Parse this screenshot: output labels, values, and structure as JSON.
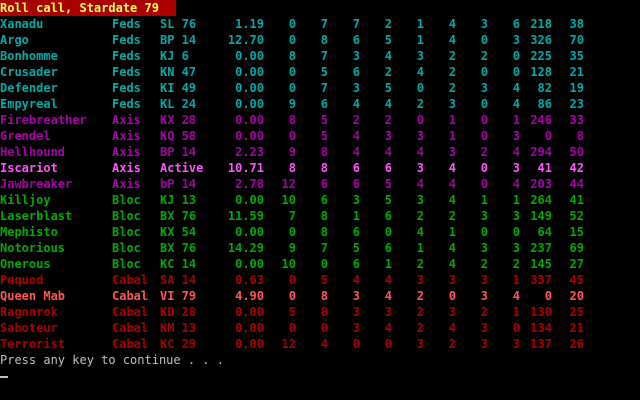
{
  "title": "Roll call, Stardate 79",
  "colors": {
    "background": "#000000",
    "title_bg": "#AA0000",
    "title_fg": "#FFFF55",
    "Feds": "#00AAAA",
    "Axis_dim": "#AA00AA",
    "Axis_bright": "#FF55FF",
    "Bloc": "#00AA00",
    "Cabal_dim": "#AA0000",
    "Cabal_bright": "#FF5555",
    "prompt": "#C0C0C0"
  },
  "rows": [
    {
      "name": "Xanadu",
      "faction": "Feds",
      "status": "SL 76",
      "v1": "1.19",
      "c1": "0",
      "c2": "7",
      "c3": "7",
      "c4": "2",
      "c5": "1",
      "c6": "4",
      "c7": "3",
      "c8": "6",
      "c9": "218",
      "c10": "38",
      "color": "Feds"
    },
    {
      "name": "Argo",
      "faction": "Feds",
      "status": "BP 14",
      "v1": "12.70",
      "c1": "0",
      "c2": "8",
      "c3": "6",
      "c4": "5",
      "c5": "1",
      "c6": "4",
      "c7": "0",
      "c8": "3",
      "c9": "326",
      "c10": "70",
      "color": "Feds"
    },
    {
      "name": "Bonhomme",
      "faction": "Feds",
      "status": "KJ 6",
      "v1": "0.00",
      "c1": "8",
      "c2": "7",
      "c3": "3",
      "c4": "4",
      "c5": "3",
      "c6": "2",
      "c7": "2",
      "c8": "0",
      "c9": "225",
      "c10": "35",
      "color": "Feds"
    },
    {
      "name": "Crusader",
      "faction": "Feds",
      "status": "KN 47",
      "v1": "0.00",
      "c1": "0",
      "c2": "5",
      "c3": "6",
      "c4": "2",
      "c5": "4",
      "c6": "2",
      "c7": "0",
      "c8": "0",
      "c9": "128",
      "c10": "21",
      "color": "Feds"
    },
    {
      "name": "Defender",
      "faction": "Feds",
      "status": "KI 49",
      "v1": "0.00",
      "c1": "0",
      "c2": "7",
      "c3": "3",
      "c4": "5",
      "c5": "0",
      "c6": "2",
      "c7": "3",
      "c8": "4",
      "c9": "82",
      "c10": "19",
      "color": "Feds"
    },
    {
      "name": "Empyreal",
      "faction": "Feds",
      "status": "KL 24",
      "v1": "0.00",
      "c1": "9",
      "c2": "6",
      "c3": "4",
      "c4": "4",
      "c5": "2",
      "c6": "3",
      "c7": "0",
      "c8": "4",
      "c9": "86",
      "c10": "23",
      "color": "Feds"
    },
    {
      "name": "Firebreather",
      "faction": "Axis",
      "status": "KX 28",
      "v1": "0.00",
      "c1": "8",
      "c2": "5",
      "c3": "2",
      "c4": "2",
      "c5": "0",
      "c6": "1",
      "c7": "0",
      "c8": "1",
      "c9": "246",
      "c10": "33",
      "color": "Axis_dim"
    },
    {
      "name": "Grendel",
      "faction": "Axis",
      "status": "KQ 58",
      "v1": "0.00",
      "c1": "0",
      "c2": "5",
      "c3": "4",
      "c4": "3",
      "c5": "3",
      "c6": "1",
      "c7": "0",
      "c8": "3",
      "c9": "0",
      "c10": "8",
      "color": "Axis_dim"
    },
    {
      "name": "Hellhound",
      "faction": "Axis",
      "status": "BP 14",
      "v1": "2.23",
      "c1": "9",
      "c2": "8",
      "c3": "4",
      "c4": "4",
      "c5": "4",
      "c6": "3",
      "c7": "2",
      "c8": "4",
      "c9": "294",
      "c10": "50",
      "color": "Axis_dim"
    },
    {
      "name": "Iscariot",
      "faction": "Axis",
      "status": "Active",
      "v1": "10.71",
      "c1": "8",
      "c2": "8",
      "c3": "6",
      "c4": "6",
      "c5": "3",
      "c6": "4",
      "c7": "0",
      "c8": "3",
      "c9": "41",
      "c10": "42",
      "color": "Axis_bright"
    },
    {
      "name": "Jawbreaker",
      "faction": "Axis",
      "status": "bP 14",
      "v1": "2.78",
      "c1": "12",
      "c2": "6",
      "c3": "6",
      "c4": "5",
      "c5": "4",
      "c6": "4",
      "c7": "0",
      "c8": "4",
      "c9": "203",
      "c10": "44",
      "color": "Axis_dim"
    },
    {
      "name": "Killjoy",
      "faction": "Bloc",
      "status": "KJ 13",
      "v1": "0.00",
      "c1": "10",
      "c2": "6",
      "c3": "3",
      "c4": "5",
      "c5": "3",
      "c6": "4",
      "c7": "1",
      "c8": "1",
      "c9": "264",
      "c10": "41",
      "color": "Bloc"
    },
    {
      "name": "Laserblast",
      "faction": "Bloc",
      "status": "BX 76",
      "v1": "11.59",
      "c1": "7",
      "c2": "8",
      "c3": "1",
      "c4": "6",
      "c5": "2",
      "c6": "2",
      "c7": "3",
      "c8": "3",
      "c9": "149",
      "c10": "52",
      "color": "Bloc"
    },
    {
      "name": "Mephisto",
      "faction": "Bloc",
      "status": "KX 54",
      "v1": "0.00",
      "c1": "0",
      "c2": "8",
      "c3": "6",
      "c4": "0",
      "c5": "4",
      "c6": "1",
      "c7": "0",
      "c8": "0",
      "c9": "64",
      "c10": "15",
      "color": "Bloc"
    },
    {
      "name": "Notorious",
      "faction": "Bloc",
      "status": "BX 76",
      "v1": "14.29",
      "c1": "9",
      "c2": "7",
      "c3": "5",
      "c4": "6",
      "c5": "1",
      "c6": "4",
      "c7": "3",
      "c8": "3",
      "c9": "237",
      "c10": "69",
      "color": "Bloc"
    },
    {
      "name": "Onerous",
      "faction": "Bloc",
      "status": "KC 14",
      "v1": "0.00",
      "c1": "10",
      "c2": "0",
      "c3": "6",
      "c4": "1",
      "c5": "2",
      "c6": "4",
      "c7": "2",
      "c8": "2",
      "c9": "145",
      "c10": "27",
      "color": "Bloc"
    },
    {
      "name": "Pequod",
      "faction": "Cabal",
      "status": "SA 14",
      "v1": "0.63",
      "c1": "0",
      "c2": "5",
      "c3": "4",
      "c4": "4",
      "c5": "3",
      "c6": "3",
      "c7": "3",
      "c8": "1",
      "c9": "337",
      "c10": "45",
      "color": "Cabal_dim"
    },
    {
      "name": "Queen Mab",
      "faction": "Cabal",
      "status": "VI 79",
      "v1": "4.90",
      "c1": "0",
      "c2": "8",
      "c3": "3",
      "c4": "4",
      "c5": "2",
      "c6": "0",
      "c7": "3",
      "c8": "4",
      "c9": "0",
      "c10": "20",
      "color": "Cabal_bright"
    },
    {
      "name": "Ragnarok",
      "faction": "Cabal",
      "status": "KD 28",
      "v1": "0.00",
      "c1": "5",
      "c2": "8",
      "c3": "3",
      "c4": "3",
      "c5": "2",
      "c6": "3",
      "c7": "2",
      "c8": "1",
      "c9": "130",
      "c10": "25",
      "color": "Cabal_dim"
    },
    {
      "name": "Saboteur",
      "faction": "Cabal",
      "status": "KM 13",
      "v1": "0.00",
      "c1": "0",
      "c2": "0",
      "c3": "3",
      "c4": "4",
      "c5": "2",
      "c6": "4",
      "c7": "3",
      "c8": "0",
      "c9": "134",
      "c10": "21",
      "color": "Cabal_dim"
    },
    {
      "name": "Terrorist",
      "faction": "Cabal",
      "status": "KC 29",
      "v1": "0.00",
      "c1": "12",
      "c2": "4",
      "c3": "0",
      "c4": "0",
      "c5": "3",
      "c6": "2",
      "c7": "3",
      "c8": "3",
      "c9": "137",
      "c10": "26",
      "color": "Cabal_dim"
    }
  ],
  "prompt": "Press any key to continue . . .",
  "cursor": "_"
}
